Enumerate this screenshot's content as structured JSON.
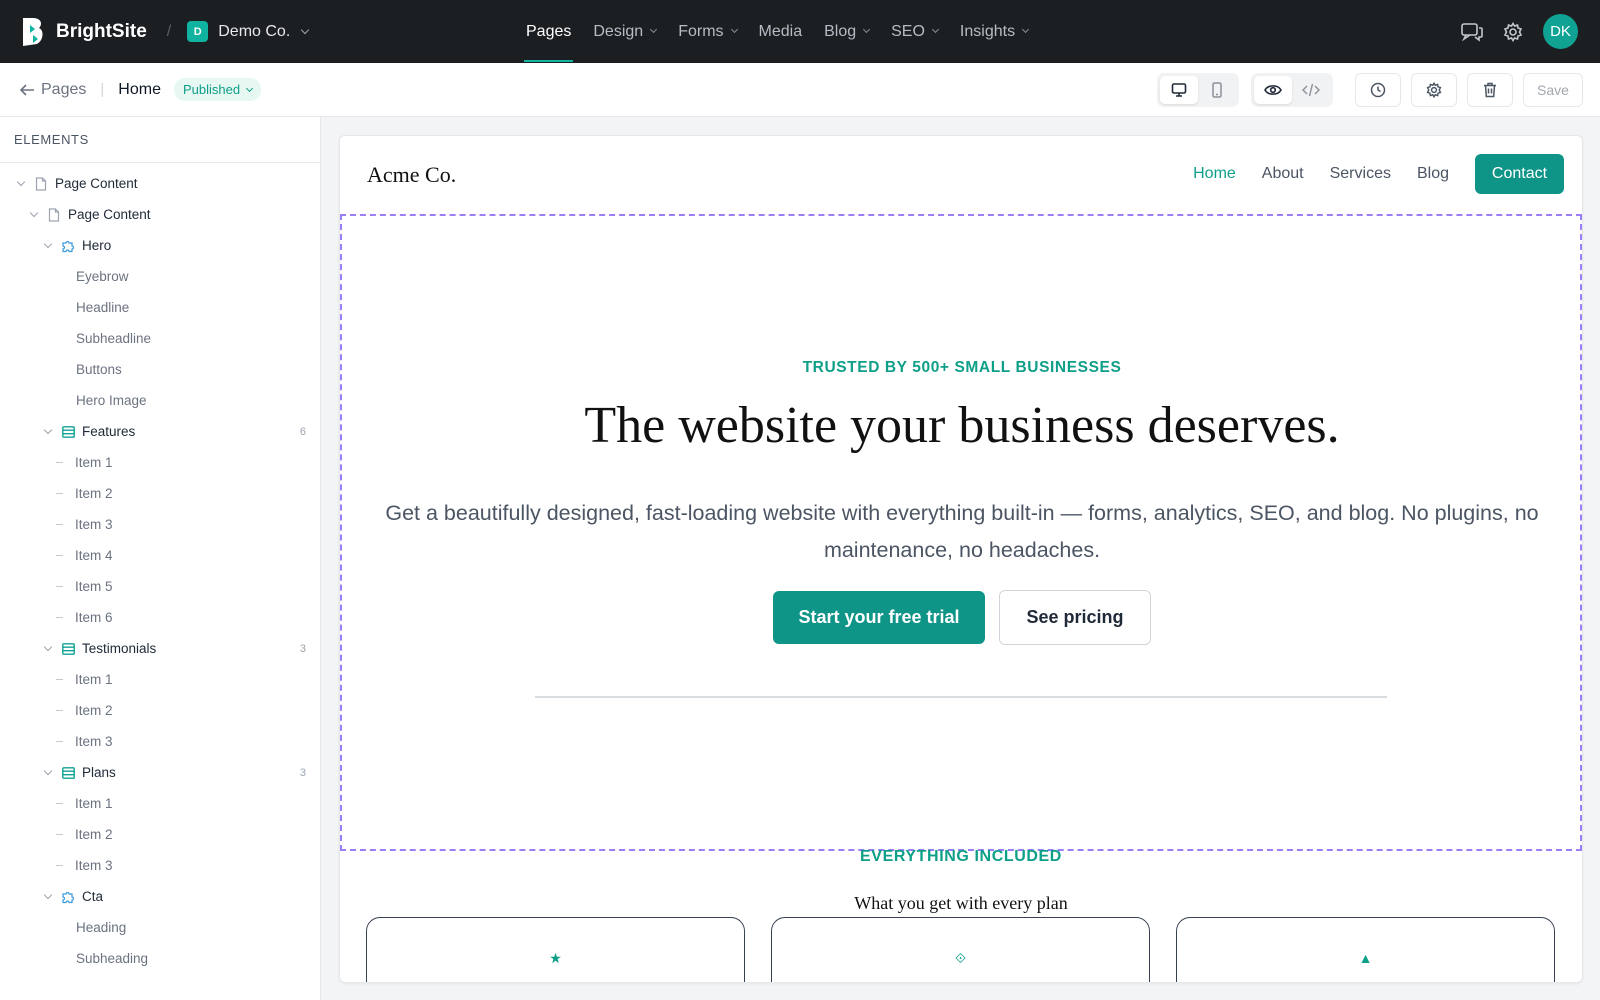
{
  "topnav": {
    "brand": "BrightSite",
    "separator": "/",
    "workspace_initial": "D",
    "workspace_name": "Demo Co.",
    "menu": [
      {
        "label": "Pages"
      },
      {
        "label": "Design"
      },
      {
        "label": "Forms"
      },
      {
        "label": "Media"
      },
      {
        "label": "Blog"
      },
      {
        "label": "SEO"
      },
      {
        "label": "Insights"
      }
    ],
    "avatar_initials": "DK",
    "icons": [
      "chat-icon",
      "gear-icon"
    ]
  },
  "toolbar": {
    "back_label": "Pages",
    "separator": "|",
    "current_page": "Home",
    "status": "Published",
    "save_label": "Save",
    "icons": [
      "desktop-icon",
      "mobile-icon",
      "eye-icon",
      "code-icon",
      "history-icon",
      "settings-icon",
      "trash-icon"
    ]
  },
  "sidebar": {
    "title": "ELEMENTS",
    "tree": [
      {
        "label": "Page Content",
        "kind": "page"
      },
      {
        "label": "Page Content",
        "kind": "page"
      },
      {
        "label": "Hero",
        "kind": "component"
      },
      {
        "label": "Eyebrow",
        "kind": "field"
      },
      {
        "label": "Headline",
        "kind": "field"
      },
      {
        "label": "Subheadline",
        "kind": "field"
      },
      {
        "label": "Buttons",
        "kind": "field"
      },
      {
        "label": "Hero Image",
        "kind": "field"
      },
      {
        "label": "Features",
        "kind": "list",
        "count": "6"
      },
      {
        "label": "Item 1",
        "kind": "item"
      },
      {
        "label": "Item 2",
        "kind": "item"
      },
      {
        "label": "Item 3",
        "kind": "item"
      },
      {
        "label": "Item 4",
        "kind": "item"
      },
      {
        "label": "Item 5",
        "kind": "item"
      },
      {
        "label": "Item 6",
        "kind": "item"
      },
      {
        "label": "Testimonials",
        "kind": "list",
        "count": "3"
      },
      {
        "label": "Item 1",
        "kind": "item"
      },
      {
        "label": "Item 2",
        "kind": "item"
      },
      {
        "label": "Item 3",
        "kind": "item"
      },
      {
        "label": "Plans",
        "kind": "list",
        "count": "3"
      },
      {
        "label": "Item 1",
        "kind": "item"
      },
      {
        "label": "Item 2",
        "kind": "item"
      },
      {
        "label": "Item 3",
        "kind": "item"
      },
      {
        "label": "Cta",
        "kind": "component"
      },
      {
        "label": "Heading",
        "kind": "field"
      },
      {
        "label": "Subheading",
        "kind": "field"
      }
    ]
  },
  "site": {
    "logo": "Acme Co.",
    "nav": [
      {
        "label": "Home"
      },
      {
        "label": "About"
      },
      {
        "label": "Services"
      },
      {
        "label": "Blog"
      }
    ],
    "cta": "Contact",
    "hero": {
      "eyebrow": "TRUSTED BY 500+ SMALL BUSINESSES",
      "headline": "The website your business deserves.",
      "subheadline": "Get a beautifully designed, fast-loading website with everything built-in — forms, analytics, SEO, and blog. No plugins, no maintenance, no headaches.",
      "primary_button": "Start your free trial",
      "secondary_button": "See pricing"
    },
    "features": {
      "eyebrow": "EVERYTHING INCLUDED",
      "title": "What you get with every plan",
      "card_icons": [
        "★",
        "⟐",
        "▲"
      ]
    }
  },
  "colors": {
    "accent": "#0f9488",
    "topbar": "#1c1f22",
    "selection": "#9b7df6"
  }
}
